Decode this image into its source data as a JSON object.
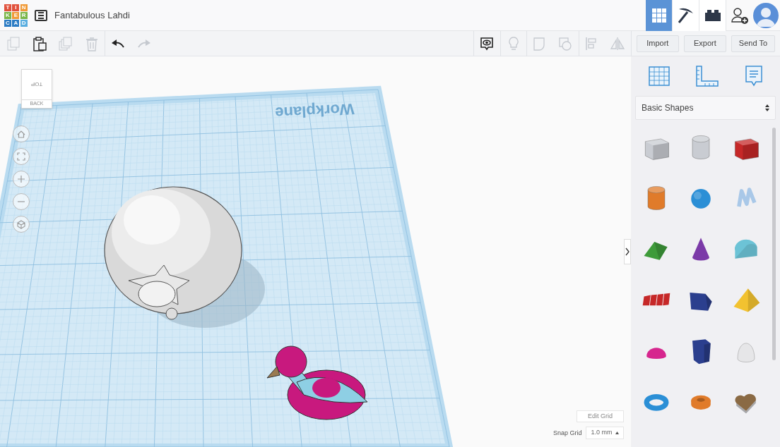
{
  "logo": {
    "letters": [
      {
        "char": "T",
        "color": "#e1523d"
      },
      {
        "char": "I",
        "color": "#e1523d"
      },
      {
        "char": "N",
        "color": "#f09a37"
      },
      {
        "char": "K",
        "color": "#7ab648"
      },
      {
        "char": "E",
        "color": "#f09a37"
      },
      {
        "char": "R",
        "color": "#7ab648"
      },
      {
        "char": "C",
        "color": "#2c7cc4"
      },
      {
        "char": "A",
        "color": "#2c7cc4"
      },
      {
        "char": "D",
        "color": "#5aaee0"
      }
    ]
  },
  "title": "Fantabulous Lahdi",
  "edit_tools": [
    {
      "kind": "copy",
      "disabled": true
    },
    {
      "kind": "paste",
      "disabled": false
    },
    {
      "kind": "duplicate",
      "disabled": true
    },
    {
      "kind": "delete",
      "disabled": true
    },
    {
      "kind": "undo",
      "disabled": false
    },
    {
      "kind": "redo",
      "disabled": true
    }
  ],
  "view_tools": [
    {
      "kind": "notes",
      "disabled": false
    },
    {
      "kind": "light",
      "disabled": true
    },
    {
      "kind": "group",
      "disabled": true
    },
    {
      "kind": "ungroup",
      "disabled": true
    },
    {
      "kind": "align",
      "disabled": true
    },
    {
      "kind": "mirror",
      "disabled": true
    }
  ],
  "nav_tabs": [
    {
      "kind": "grid",
      "selected": true
    },
    {
      "kind": "pickaxe",
      "selected": false
    },
    {
      "kind": "brick",
      "selected": false
    }
  ],
  "actions": [
    "Import",
    "Export",
    "Send To"
  ],
  "view_cube": {
    "top": "TOP",
    "side": "BACK"
  },
  "workplane": {
    "label": "Workplane"
  },
  "panel": {
    "category": "Basic Shapes",
    "shapes": [
      {
        "kind": "box",
        "color": "#c9ccd2"
      },
      {
        "kind": "cylinder",
        "color": "#c9ccd2"
      },
      {
        "kind": "box",
        "color": "#c62828"
      },
      {
        "kind": "cylinder",
        "color": "#e07b2a"
      },
      {
        "kind": "sphere",
        "color": "#2b8fd6"
      },
      {
        "kind": "scribble",
        "color": "#a9c8e8"
      },
      {
        "kind": "roof",
        "color": "#3e9b3a"
      },
      {
        "kind": "cone",
        "color": "#7b3aa8"
      },
      {
        "kind": "round-roof",
        "color": "#6cc3d6"
      },
      {
        "kind": "text",
        "color": "#c62828"
      },
      {
        "kind": "polygon",
        "color": "#2b3f8e"
      },
      {
        "kind": "pyramid",
        "color": "#f2c230"
      },
      {
        "kind": "half-sphere",
        "color": "#d6268e"
      },
      {
        "kind": "hexagonal-prism",
        "color": "#2b3f8e"
      },
      {
        "kind": "paraboloid",
        "color": "#e6e6e8"
      },
      {
        "kind": "torus",
        "color": "#2b8fd6"
      },
      {
        "kind": "tube",
        "color": "#e07b2a"
      },
      {
        "kind": "heart",
        "color": "#8a6a44"
      }
    ]
  },
  "grid_controls": {
    "edit": "Edit Grid",
    "snap_label": "Snap Grid",
    "snap_value": "1.0 mm"
  }
}
